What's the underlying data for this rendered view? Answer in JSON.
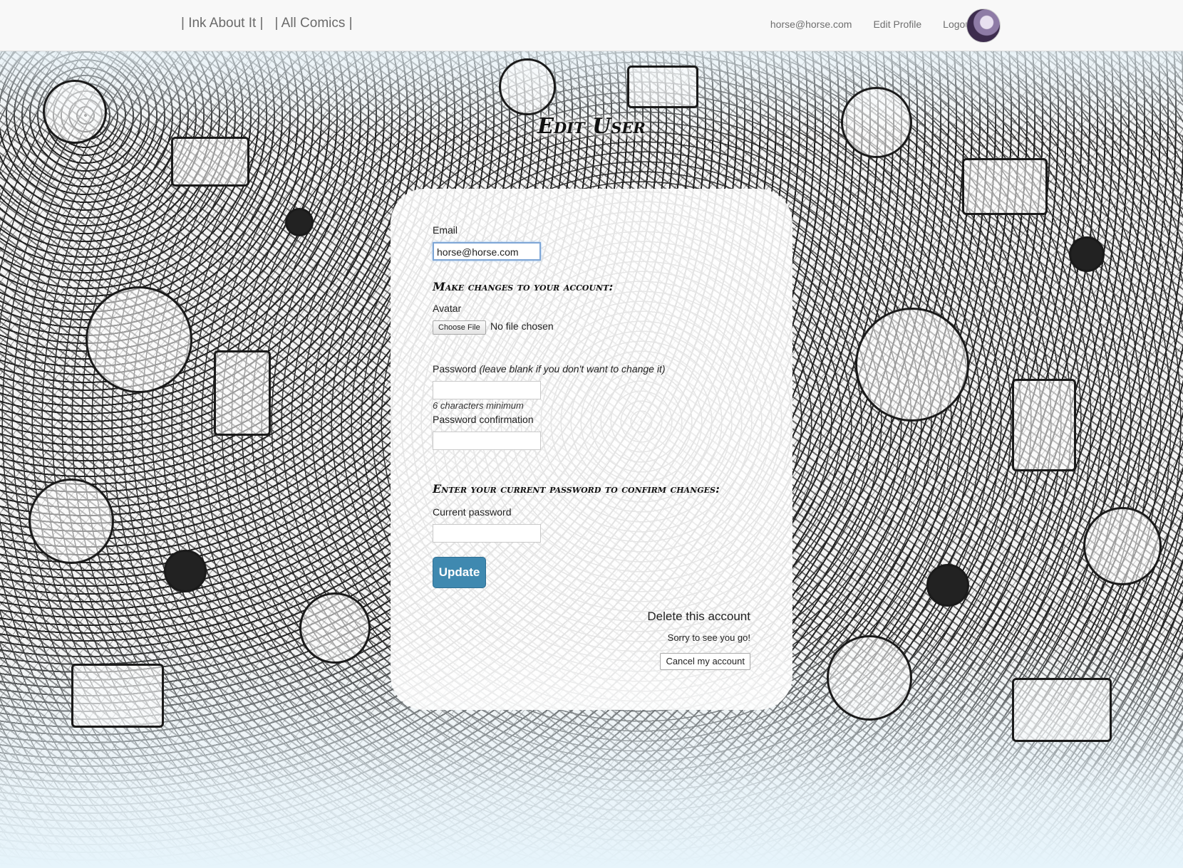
{
  "nav": {
    "brand": "| Ink About It |",
    "all_comics": "| All Comics |",
    "user_email": "horse@horse.com",
    "edit_profile": "Edit Profile",
    "logout": "Logout"
  },
  "page": {
    "title": "Edit User"
  },
  "form": {
    "email_label": "Email",
    "email_value": "horse@horse.com",
    "changes_heading": "Make changes to your account:",
    "avatar_label": "Avatar",
    "choose_file_label": "Choose File",
    "file_status": "No file chosen",
    "password_label": "Password",
    "password_note": "(leave blank if you don't want to change it)",
    "password_hint": "6 characters minimum",
    "password_confirmation_label": "Password confirmation",
    "confirm_heading": "Enter your current password to confirm changes:",
    "current_password_label": "Current password",
    "update_label": "Update"
  },
  "delete_section": {
    "title": "Delete this account",
    "message": "Sorry to see you go!",
    "cancel_label": "Cancel my account"
  },
  "colors": {
    "primary_button": "#3f89b0",
    "navbar_bg": "#f8f8f8",
    "focus_ring": "#7ea6d6"
  }
}
